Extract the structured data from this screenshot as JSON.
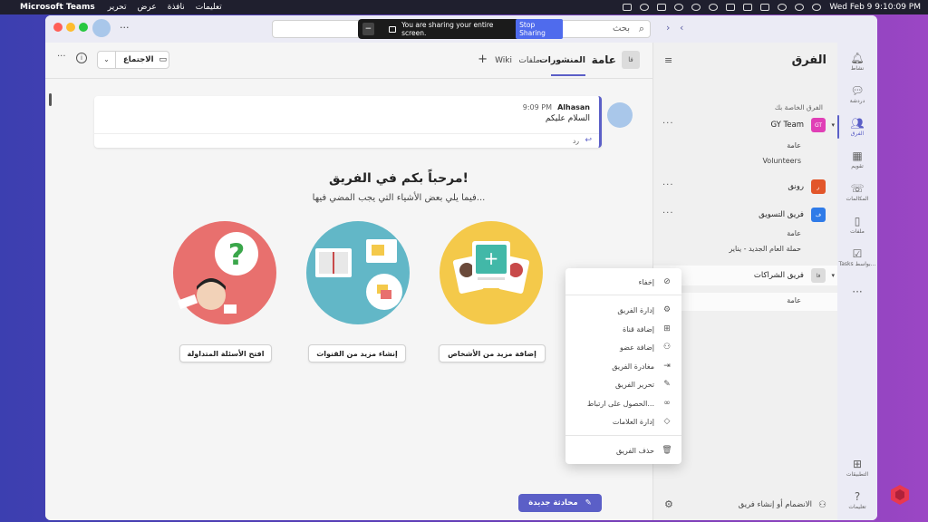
{
  "menubar": {
    "app_name": "Microsoft Teams",
    "menus": [
      "تحرير",
      "عرض",
      "نافذة",
      "تعليمات"
    ],
    "datetime": "Wed Feb 9  9:10:09 PM"
  },
  "titlebar": {
    "more": "···",
    "search_placeholder": "بحث"
  },
  "sharing": {
    "text": "You are sharing your entire screen.",
    "stop_label": "Stop Sharing"
  },
  "rail": {
    "items": [
      {
        "label": "نشاط",
        "icon": "bell-icon"
      },
      {
        "label": "دردشة",
        "icon": "chat-icon"
      },
      {
        "label": "الفرق",
        "icon": "teams-icon"
      },
      {
        "label": "تقويم",
        "icon": "calendar-icon"
      },
      {
        "label": "المكالمات",
        "icon": "phone-icon"
      },
      {
        "label": "ملفات",
        "icon": "file-icon"
      },
      {
        "label": "Tasks بواسط...",
        "icon": "tasks-icon"
      }
    ],
    "more": "···",
    "apps_label": "التطبيقات",
    "help_label": "تعليمات"
  },
  "teams_panel": {
    "title": "الفرق",
    "your_teams": "الفرق الخاصة بك",
    "teams": [
      {
        "name": "GY Team",
        "avatar": "GT",
        "color": "#e03fb6",
        "channels": [
          "عامة",
          "Volunteers"
        ]
      },
      {
        "name": "رونق",
        "avatar": "ر",
        "color": "#e2562a",
        "channels": []
      },
      {
        "name": "فريق التسويق",
        "avatar": "ف",
        "color": "#2f7be8",
        "channels": [
          "عامة",
          "حملة العام الجديد - يناير"
        ]
      },
      {
        "name": "فريق الشراكات",
        "avatar": "فا",
        "color": "#dcdcdc",
        "channels": [
          "عامة"
        ]
      }
    ],
    "more": "···",
    "join_create": "الانضمام أو إنشاء فريق"
  },
  "channel": {
    "avatar": "فا",
    "name": "عامة",
    "tabs": {
      "posts": "المنشورات",
      "files": "ملفات",
      "wiki": "Wiki",
      "add": "+"
    },
    "meet_label": "الاجتماع",
    "more": "···"
  },
  "post": {
    "author": "Alhasan",
    "time": "9:09 PM",
    "text": "السلام عليكم",
    "reply_label": "رد"
  },
  "welcome": {
    "title": "مرحباً بكم في الفريق!",
    "subtitle": "فيما يلي بعض الأشياء التي يجب المضي فيها...",
    "actions": {
      "add_people": "إضافة مزيد من الأشخاص",
      "create_channels": "إنشاء مزيد من القنوات",
      "open_faq": "افتح الأسئلة المتداولة"
    }
  },
  "new_conversation": "محادثة جديدة",
  "context_menu": {
    "hide": "إخفاء",
    "manage_team": "إدارة الفريق",
    "add_channel": "إضافة قناة",
    "add_member": "إضافة عضو",
    "leave_team": "مغادرة الفريق",
    "edit_team": "تحرير الفريق",
    "get_link": "الحصول على ارتباط...",
    "manage_tags": "إدارة العلامات",
    "delete_team": "حذف الفريق"
  },
  "colors": {
    "accent": "#5b5fc7",
    "people_circle": "#f4c94a",
    "channels_circle": "#62b7c7",
    "faq_circle": "#e8706e"
  }
}
